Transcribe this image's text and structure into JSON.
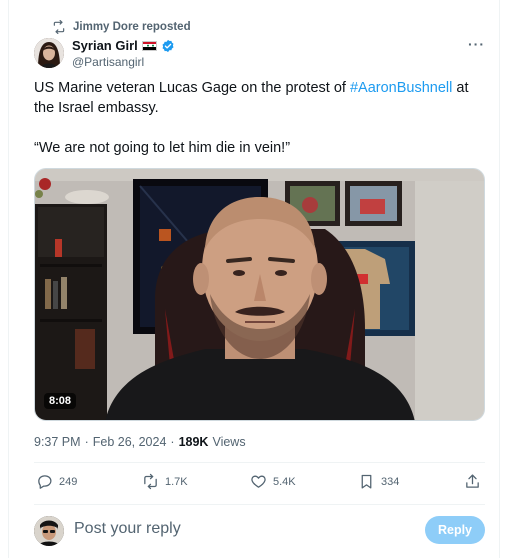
{
  "repost": {
    "icon": "repost-icon",
    "text": "Jimmy Dore reposted"
  },
  "author": {
    "name": "Syrian Girl",
    "handle": "@Partisangirl",
    "verified": true,
    "flag_colors": [
      "#ce1126",
      "#ffffff",
      "#000000"
    ]
  },
  "more_label": "···",
  "tweet": {
    "text_before": "US Marine veteran Lucas Gage on the protest of ",
    "hashtag": "#AaronBushnell",
    "text_after": " at the Israel embassy.",
    "quote": "“We are not going to let him die in vein!”"
  },
  "media": {
    "type": "video",
    "duration": "8:08"
  },
  "meta": {
    "time": "9:37 PM",
    "sep": "·",
    "date": "Feb 26, 2024",
    "sep2": "·",
    "views_count": "189K",
    "views_label": "Views"
  },
  "actions": {
    "replies": "249",
    "reposts": "1.7K",
    "likes": "5.4K",
    "bookmarks": "334"
  },
  "reply_box": {
    "placeholder": "Post your reply",
    "button": "Reply"
  },
  "colors": {
    "accent": "#1d9bf0",
    "muted": "#536471",
    "reply_button": "#8ecdf8"
  }
}
